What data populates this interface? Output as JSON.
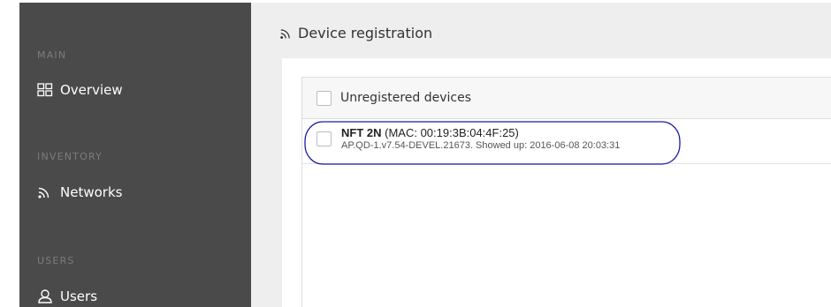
{
  "sidebar": {
    "sections": [
      {
        "label": "MAIN",
        "items": [
          {
            "label": "Overview",
            "icon": "grid-icon"
          }
        ]
      },
      {
        "label": "INVENTORY",
        "items": [
          {
            "label": "Networks",
            "icon": "wireless-icon"
          }
        ]
      },
      {
        "label": "USERS",
        "items": [
          {
            "label": "Users",
            "icon": "user-icon"
          }
        ]
      }
    ]
  },
  "header": {
    "title": "Device registration",
    "title_icon": "wireless-icon"
  },
  "panel": {
    "header_label": "Unregistered devices",
    "devices": [
      {
        "name": "NFT 2N",
        "mac": "(MAC: 00:19:3B:04:4F:25)",
        "info": "AP.QD-1.v7.54-DEVEL.21673. Showed up: 2016-06-08 20:03:31"
      }
    ]
  },
  "colors": {
    "sidebar_bg": "#4a4a4a",
    "main_bg": "#eeeeee",
    "highlight": "#1a1aa6"
  }
}
